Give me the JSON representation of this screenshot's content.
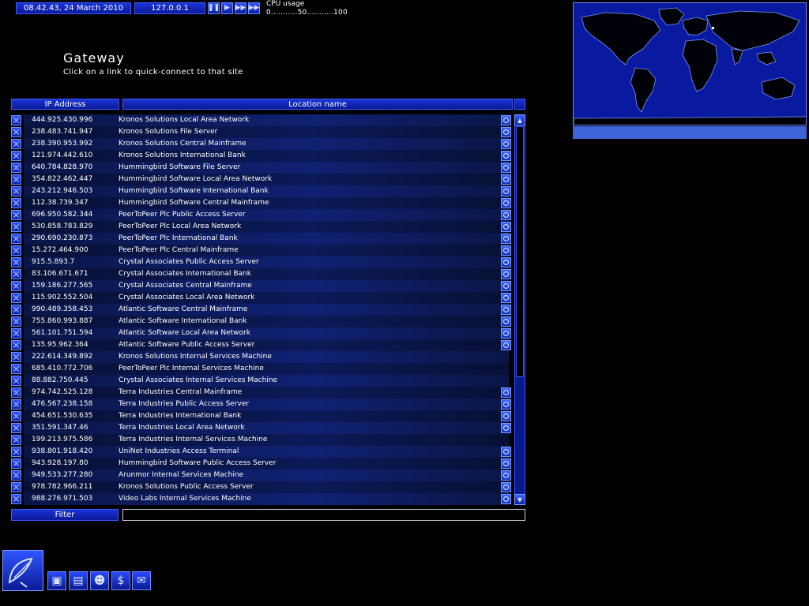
{
  "topbar": {
    "datetime": "08.42.43, 24 March 2010",
    "ip": "127.0.0.1",
    "cpu_title": "CPU usage",
    "cpu_scale": "0...........50...........100"
  },
  "page": {
    "title": "Gateway",
    "subtitle": "Click on a link to quick-connect to that site"
  },
  "table": {
    "headers": [
      "IP Address",
      "Location name"
    ],
    "rows": [
      {
        "ip": "444.925.430.996",
        "loc": "Kronos Solutions Local Area Network",
        "icon": true
      },
      {
        "ip": "238.483.741.947",
        "loc": "Kronos Solutions File Server",
        "icon": true
      },
      {
        "ip": "238.390.953.992",
        "loc": "Kronos Solutions Central Mainframe",
        "icon": true
      },
      {
        "ip": "121.974.442.610",
        "loc": "Kronos Solutions International Bank",
        "icon": true
      },
      {
        "ip": "640.784.828.970",
        "loc": "Hummingbird Software File Server",
        "icon": true
      },
      {
        "ip": "354.822.462.447",
        "loc": "Hummingbird Software Local Area Network",
        "icon": true
      },
      {
        "ip": "243.212.946.503",
        "loc": "Hummingbird Software International Bank",
        "icon": true
      },
      {
        "ip": "112.38.739.347",
        "loc": "Hummingbird Software Central Mainframe",
        "icon": true
      },
      {
        "ip": "696.950.582.344",
        "loc": "PeerToPeer Plc Public Access Server",
        "icon": true
      },
      {
        "ip": "530.858.783.829",
        "loc": "PeerToPeer Plc Local Area Network",
        "icon": true
      },
      {
        "ip": "290.690.230.873",
        "loc": "PeerToPeer Plc International Bank",
        "icon": true
      },
      {
        "ip": "15.272.464.900",
        "loc": "PeerToPeer Plc Central Mainframe",
        "icon": true
      },
      {
        "ip": "915.5.893.7",
        "loc": "Crystal Associates Public Access Server",
        "icon": true
      },
      {
        "ip": "83.106.671.671",
        "loc": "Crystal Associates International Bank",
        "icon": true
      },
      {
        "ip": "159.186.277.565",
        "loc": "Crystal Associates Central Mainframe",
        "icon": true
      },
      {
        "ip": "115.902.552.504",
        "loc": "Crystal Associates Local Area Network",
        "icon": true
      },
      {
        "ip": "990.489.358.453",
        "loc": "Atlantic Software Central Mainframe",
        "icon": true
      },
      {
        "ip": "755.860.993.887",
        "loc": "Atlantic Software International Bank",
        "icon": true
      },
      {
        "ip": "561.101.751.594",
        "loc": "Atlantic Software Local Area Network",
        "icon": true
      },
      {
        "ip": "135.95.962.364",
        "loc": "Atlantic Software Public Access Server",
        "icon": true
      },
      {
        "ip": "222.614.349.892",
        "loc": "Kronos Solutions Internal Services Machine",
        "icon": false
      },
      {
        "ip": "685.410.772.706",
        "loc": "PeerToPeer Plc Internal Services Machine",
        "icon": false
      },
      {
        "ip": "88.882.750.445",
        "loc": "Crystal Associates Internal Services Machine",
        "icon": false
      },
      {
        "ip": "974.742.525.128",
        "loc": "Terra Industries Central Mainframe",
        "icon": true
      },
      {
        "ip": "476.567.238.158",
        "loc": "Terra Industries Public Access Server",
        "icon": true
      },
      {
        "ip": "454.651.530.635",
        "loc": "Terra Industries International Bank",
        "icon": true
      },
      {
        "ip": "351.591.347.46",
        "loc": "Terra Industries Local Area Network",
        "icon": true
      },
      {
        "ip": "199.213.975.586",
        "loc": "Terra Industries Internal Services Machine",
        "icon": false
      },
      {
        "ip": "938.801.918.420",
        "loc": "UniNet Industries Access Terminal",
        "icon": true
      },
      {
        "ip": "943.928.197.80",
        "loc": "Hummingbird Software Public Access Server",
        "icon": true
      },
      {
        "ip": "949.533.277.280",
        "loc": "Arunmor Internal Services Machine",
        "icon": true
      },
      {
        "ip": "978.782.966.211",
        "loc": "Kronos Solutions Public Access Server",
        "icon": true
      },
      {
        "ip": "988.276.971.503",
        "loc": "Video Labs Internal Services Machine",
        "icon": true
      }
    ]
  },
  "filter": {
    "label": "Filter",
    "value": ""
  },
  "colors": {
    "accent": "#1a33d6",
    "background": "#000000",
    "map": "#0a1aa0"
  }
}
